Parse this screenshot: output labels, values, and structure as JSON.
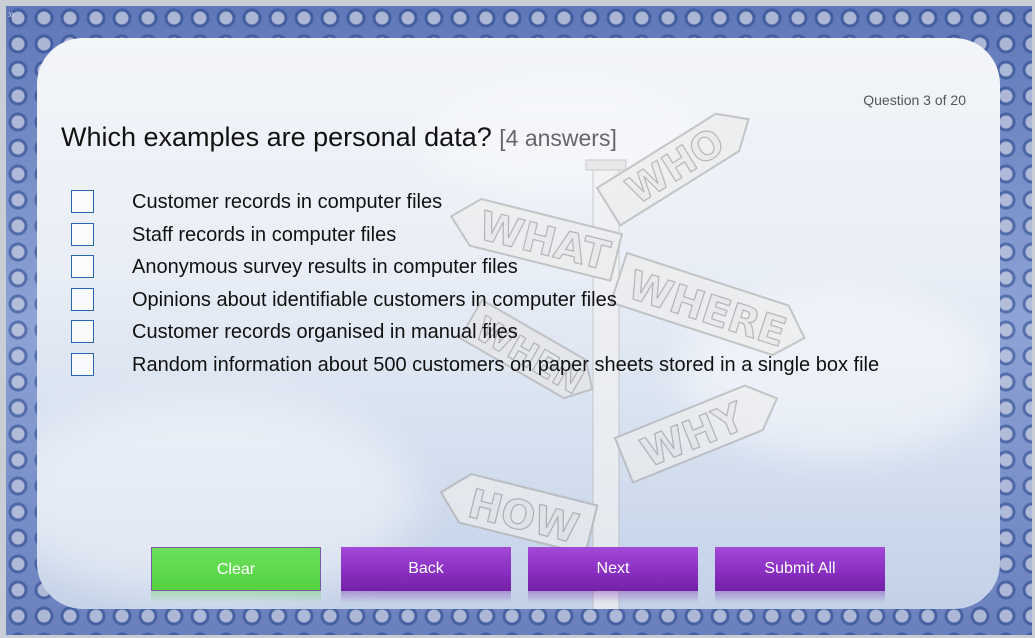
{
  "app": {
    "expand_icon": "double-chevron-right-icon",
    "expand_glyph": "»"
  },
  "question": {
    "counter": "Question 3 of 20",
    "title": "Which examples are personal data?",
    "answer_count": "[4 answers]"
  },
  "options": [
    {
      "label": "Customer records in computer files",
      "checked": false
    },
    {
      "label": "Staff records in computer files",
      "checked": false
    },
    {
      "label": "Anonymous survey results in computer files",
      "checked": false
    },
    {
      "label": "Opinions about identifiable customers in computer files",
      "checked": false
    },
    {
      "label": "Customer records organised in manual files",
      "checked": false
    },
    {
      "label": "Random information about 500 customers on paper sheets stored in a single box file",
      "checked": false
    }
  ],
  "background_signs": [
    "WHO",
    "WHAT",
    "WHERE",
    "WHEN",
    "WHY",
    "HOW"
  ],
  "buttons": {
    "clear": "Clear",
    "back": "Back",
    "next": "Next",
    "submit_all": "Submit All"
  },
  "colors": {
    "clear_button": "#5fd94c",
    "nav_button": "#8a2fc3",
    "checkbox_border": "#2a66b5"
  }
}
